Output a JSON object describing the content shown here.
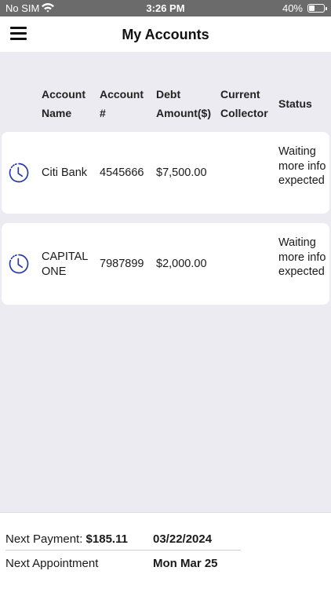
{
  "status_bar": {
    "carrier": "No SIM",
    "time": "3:26 PM",
    "battery": "40%"
  },
  "nav": {
    "title": "My Accounts"
  },
  "table": {
    "headers": {
      "account_name": [
        "Account",
        "Name"
      ],
      "account_number": [
        "Account",
        "#"
      ],
      "debt_amount": [
        "Debt",
        "Amount($)"
      ],
      "current_collector": [
        "Current",
        "Collector"
      ],
      "status": "Status"
    },
    "rows": [
      {
        "name": "Citi Bank",
        "number": "4545666",
        "debt": "$7,500.00",
        "collector": "",
        "status": "Waiting more info expected",
        "icon": "clock-icon"
      },
      {
        "name": "CAPITAL ONE",
        "number": "7987899",
        "debt": "$2,000.00",
        "collector": "",
        "status": "Waiting more info expected",
        "icon": "clock-icon"
      }
    ]
  },
  "footer": {
    "next_payment_label": "Next Payment:",
    "next_payment_amount": "$185.11",
    "next_payment_date": "03/22/2024",
    "next_appointment_label": "Next Appointment",
    "next_appointment_date": "Mon Mar 25"
  },
  "colors": {
    "accent": "#2d3a9a",
    "background": "#ecebf1",
    "status_bar": "#6b6b6b"
  }
}
